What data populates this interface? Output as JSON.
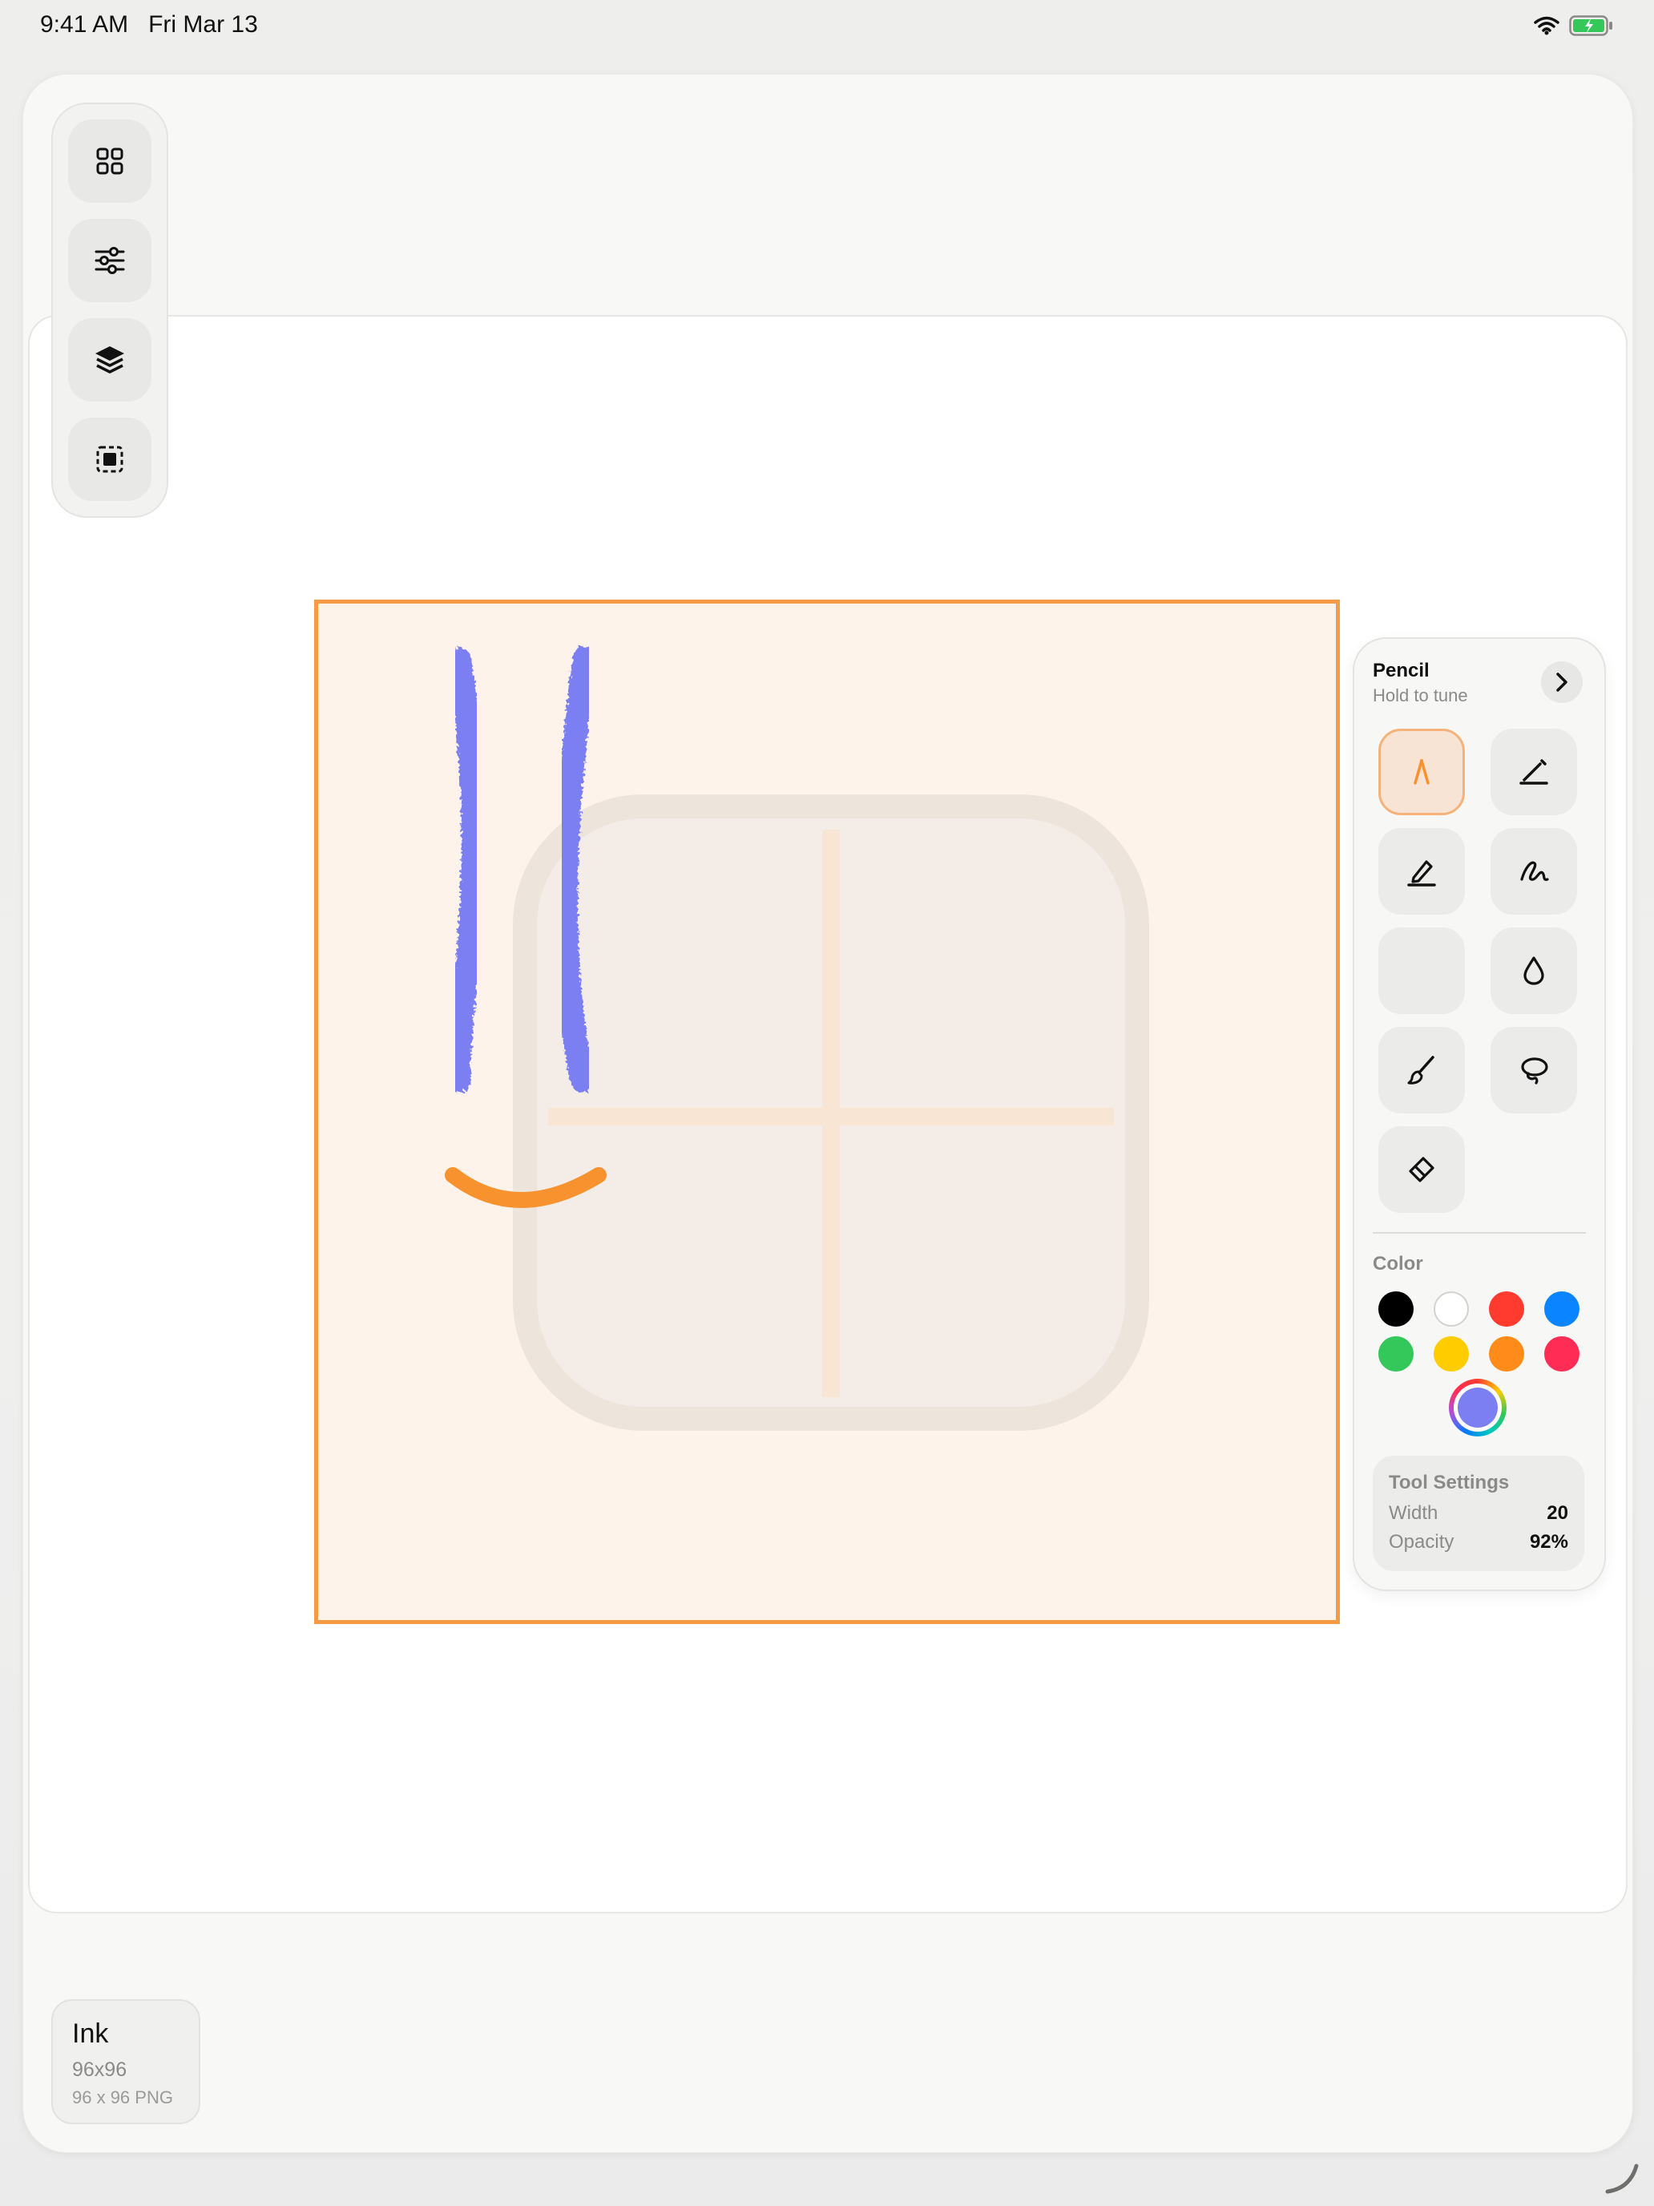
{
  "status_bar": {
    "time": "9:41 AM",
    "date": "Fri Mar 13",
    "icons": [
      "wifi-icon",
      "battery-charging-icon"
    ]
  },
  "left_toolbar": {
    "buttons": [
      {
        "icon": "grid-icon"
      },
      {
        "icon": "sliders-icon"
      },
      {
        "icon": "layers-icon"
      },
      {
        "icon": "selection-icon"
      }
    ]
  },
  "tool_panel": {
    "title": "Pencil",
    "subtitle": "Hold to tune",
    "tools": [
      {
        "icon": "pencil-tip-icon",
        "active": true
      },
      {
        "icon": "pen-icon",
        "active": false
      },
      {
        "icon": "marker-icon",
        "active": false
      },
      {
        "icon": "scribble-icon",
        "active": false
      },
      {
        "icon": "blank-tool",
        "active": false
      },
      {
        "icon": "ink-drop-icon",
        "active": false
      },
      {
        "icon": "brush-icon",
        "active": false
      },
      {
        "icon": "lasso-icon",
        "active": false
      },
      {
        "icon": "eraser-icon",
        "active": false
      }
    ],
    "color_label": "Color",
    "swatches": [
      "#000000",
      "#ffffff",
      "#ff3b30",
      "#0a84ff",
      "#34c759",
      "#ffcc00",
      "#ff8c1a",
      "#ff2d55"
    ],
    "current_color": "#7b7ff2",
    "settings": {
      "title": "Tool Settings",
      "width_label": "Width",
      "width_value": "20",
      "opacity_label": "Opacity",
      "opacity_value": "92%"
    }
  },
  "file_card": {
    "name": "Ink",
    "size": "96x96",
    "format": "96 x 96 PNG"
  },
  "colors": {
    "accent": "#f59a45",
    "stroke_blue": "#7b7ff2",
    "stroke_orange": "#f7922e",
    "artboard_bg": "#fdf3ea"
  }
}
